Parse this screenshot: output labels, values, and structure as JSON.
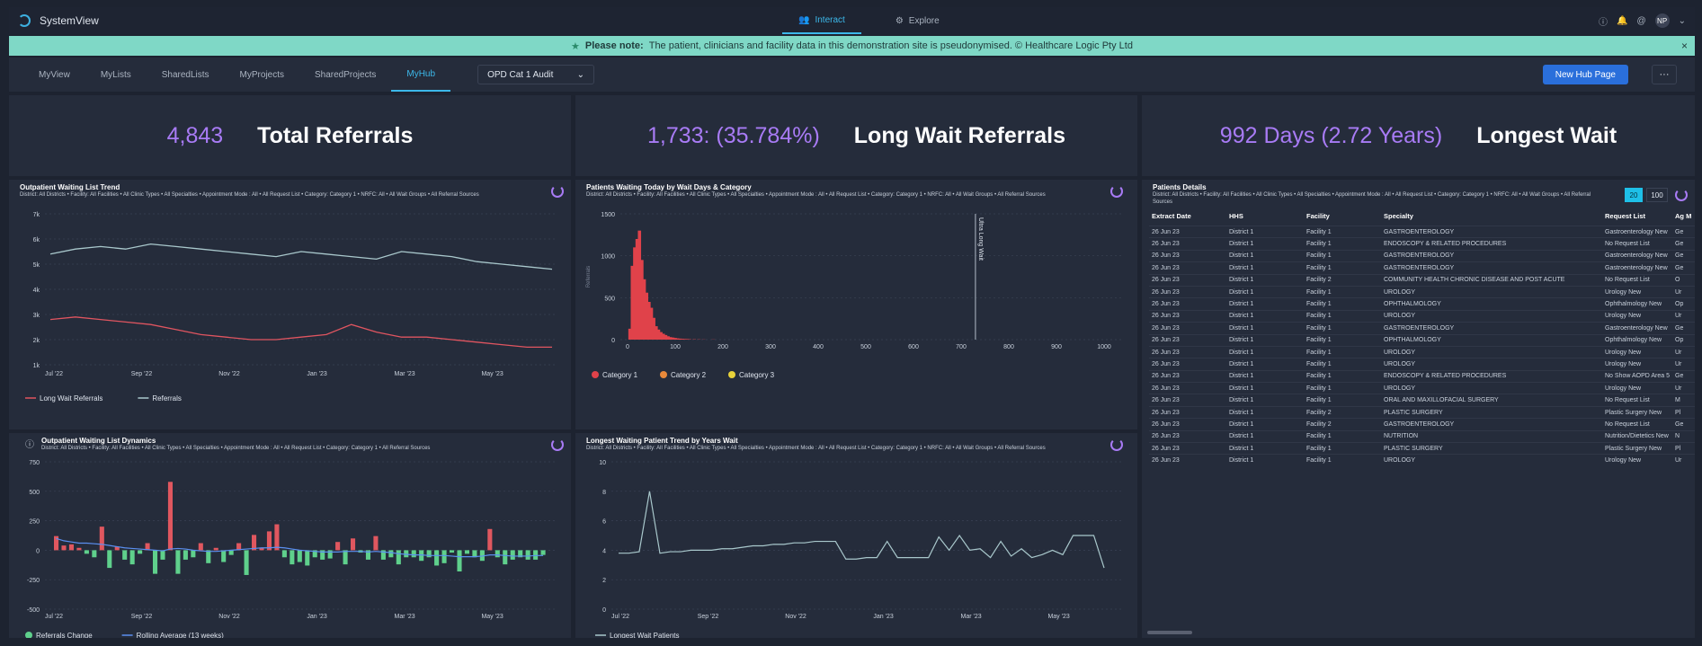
{
  "app": {
    "title": "SystemView",
    "modes": [
      {
        "label": "Interact"
      },
      {
        "label": "Explore"
      }
    ],
    "user_initials": "NP"
  },
  "notice": {
    "bold": "Please note:",
    "text": "The patient, clinicians and facility data in this demonstration site is pseudonymised. © Healthcare Logic Pty Ltd",
    "close": "×"
  },
  "tabs": [
    {
      "label": "MyView"
    },
    {
      "label": "MyLists"
    },
    {
      "label": "SharedLists"
    },
    {
      "label": "MyProjects"
    },
    {
      "label": "SharedProjects"
    },
    {
      "label": "MyHub"
    }
  ],
  "hub_select": "OPD Cat 1 Audit",
  "new_hub_button": "New Hub Page",
  "more_button": "···",
  "kpis": [
    {
      "value": "4,843",
      "label": "Total Referrals"
    },
    {
      "value": "1,733: (35.784%)",
      "label": "Long Wait Referrals"
    },
    {
      "value": "992 Days (2.72 Years)",
      "label": "Longest Wait"
    }
  ],
  "filter_text": "District: All Districts  •  Facility: All Facilities  •  All Clinic Types  •  All Specialties  •  Appointment Mode : All  •  All Request List  •  Category: Category 1  •  NRFC: All  •  All Wait Groups  •  All Referral Sources",
  "filter_text_b": "District: All Districts  •  Facility: All Facilities  •  All Clinic Types  •  All Specialties  •  Appointment Mode : All  •  All Request List  •  Category: Category 1  •  All Referral Sources",
  "chart_data": [
    {
      "title": "Outpatient Waiting List Trend",
      "type": "line",
      "x": [
        "Jul '22",
        "Sep '22",
        "Nov '22",
        "Jan '23",
        "Mar '23",
        "May '23"
      ],
      "ylim": [
        1000,
        7000
      ],
      "yticks": [
        "1k",
        "2k",
        "3k",
        "4k",
        "5k",
        "6k",
        "7k"
      ],
      "series": [
        {
          "name": "Referrals",
          "color": "#a9c8cc",
          "values": [
            5400,
            5600,
            5700,
            5600,
            5800,
            5700,
            5600,
            5500,
            5400,
            5300,
            5500,
            5400,
            5300,
            5200,
            5500,
            5400,
            5300,
            5100,
            5000,
            4900,
            4800
          ]
        },
        {
          "name": "Long Wait Referrals",
          "color": "#e05560",
          "values": [
            2800,
            2900,
            2800,
            2700,
            2600,
            2400,
            2200,
            2100,
            2000,
            2000,
            2100,
            2200,
            2600,
            2300,
            2100,
            2100,
            2000,
            1900,
            1800,
            1700,
            1700
          ]
        }
      ]
    },
    {
      "title": "Patients Waiting Today by Wait Days & Category",
      "type": "bar",
      "ylabel": "Referrals",
      "ylim": [
        0,
        1500
      ],
      "yticks": [
        "0",
        "500",
        "1000",
        "1500"
      ],
      "xticks": [
        "0",
        "100",
        "200",
        "300",
        "400",
        "500",
        "600",
        "700",
        "800",
        "900",
        "1000"
      ],
      "annotation": {
        "label": "Ultra Long Wait",
        "x": 730
      },
      "series": [
        {
          "name": "Category 1",
          "color": "#e0424a"
        },
        {
          "name": "Category 2",
          "color": "#e8893a"
        },
        {
          "name": "Category 3",
          "color": "#e8d23a"
        }
      ],
      "bars": [
        {
          "x": 5,
          "v": 130
        },
        {
          "x": 10,
          "v": 880
        },
        {
          "x": 15,
          "v": 1100
        },
        {
          "x": 20,
          "v": 1200
        },
        {
          "x": 25,
          "v": 1300
        },
        {
          "x": 30,
          "v": 950
        },
        {
          "x": 35,
          "v": 720
        },
        {
          "x": 40,
          "v": 560
        },
        {
          "x": 45,
          "v": 450
        },
        {
          "x": 50,
          "v": 380
        },
        {
          "x": 55,
          "v": 260
        },
        {
          "x": 60,
          "v": 160
        },
        {
          "x": 65,
          "v": 120
        },
        {
          "x": 70,
          "v": 90
        },
        {
          "x": 75,
          "v": 70
        },
        {
          "x": 80,
          "v": 55
        },
        {
          "x": 85,
          "v": 40
        },
        {
          "x": 90,
          "v": 30
        },
        {
          "x": 95,
          "v": 25
        },
        {
          "x": 100,
          "v": 20
        },
        {
          "x": 105,
          "v": 15
        },
        {
          "x": 110,
          "v": 12
        },
        {
          "x": 115,
          "v": 10
        },
        {
          "x": 120,
          "v": 8
        },
        {
          "x": 125,
          "v": 7
        },
        {
          "x": 130,
          "v": 5
        },
        {
          "x": 140,
          "v": 4
        },
        {
          "x": 150,
          "v": 3
        },
        {
          "x": 160,
          "v": 2
        },
        {
          "x": 180,
          "v": 2
        }
      ]
    },
    {
      "title": "Outpatient Waiting List Dynamics",
      "type": "bar",
      "x": [
        "Jul '22",
        "Sep '22",
        "Nov '22",
        "Jan '23",
        "Mar '23",
        "May '23"
      ],
      "ylim": [
        -500,
        750
      ],
      "yticks": [
        "-500",
        "-250",
        "0",
        "250",
        "500",
        "750"
      ],
      "series": [
        {
          "name": "Referrals Change",
          "color": "#5fd08c",
          "values": [
            120,
            40,
            50,
            20,
            -30,
            -60,
            200,
            -150,
            30,
            -80,
            -120,
            -30,
            60,
            -200,
            -80,
            580,
            -200,
            -80,
            -60,
            60,
            -110,
            20,
            -100,
            -40,
            60,
            -210,
            130,
            20,
            160,
            220,
            -60,
            -120,
            -100,
            -130,
            -60,
            -80,
            -70,
            70,
            -120,
            100,
            -20,
            -80,
            120,
            -80,
            -60,
            -120,
            -60,
            -60,
            -90,
            -60,
            -130,
            -110,
            -20,
            -180,
            -30,
            -60,
            -90,
            180,
            -60,
            -120,
            -80,
            -60,
            -80,
            -80,
            -40
          ]
        },
        {
          "name": "Rolling Average (13 weeks)",
          "color": "#5b8ff0",
          "values": [
            100,
            80,
            70,
            60,
            60,
            55,
            50,
            40,
            30,
            20,
            15,
            10,
            5,
            0,
            -5,
            10,
            15,
            10,
            0,
            -5,
            -10,
            -10,
            -5,
            0,
            5,
            10,
            15,
            20,
            20,
            25,
            20,
            10,
            0,
            -5,
            -10,
            -15,
            -15,
            -15,
            -10,
            -10,
            -10,
            -15,
            -10,
            -15,
            -20,
            -30,
            -35,
            -40,
            -40,
            -45,
            -45,
            -45,
            -50,
            -55,
            -55,
            -55,
            -50,
            -40,
            -40,
            -45,
            -50,
            -50,
            -50,
            -45,
            -45
          ]
        }
      ]
    },
    {
      "title": "Longest Waiting Patient Trend by Years Wait",
      "type": "line",
      "x": [
        "Jul '22",
        "Sep '22",
        "Nov '22",
        "Jan '23",
        "Mar '23",
        "May '23"
      ],
      "ylim": [
        0,
        10
      ],
      "yticks": [
        "0",
        "2",
        "4",
        "6",
        "8",
        "10"
      ],
      "series": [
        {
          "name": "Longest Wait Patients",
          "color": "#a9c8cc",
          "values": [
            3.8,
            3.8,
            3.9,
            8.0,
            3.8,
            3.9,
            3.9,
            4.0,
            4.0,
            4.0,
            4.1,
            4.1,
            4.2,
            4.3,
            4.3,
            4.4,
            4.4,
            4.5,
            4.5,
            4.6,
            4.6,
            4.6,
            3.4,
            3.4,
            3.5,
            3.5,
            4.6,
            3.5,
            3.5,
            3.5,
            3.5,
            4.9,
            4.0,
            5.0,
            4.0,
            4.1,
            3.5,
            4.6,
            3.6,
            4.1,
            3.5,
            3.7,
            4.0,
            3.7,
            5.0,
            5.0,
            5.0,
            2.8
          ]
        }
      ]
    }
  ],
  "table": {
    "title": "Patients Details",
    "page_sizes": [
      "20",
      "100"
    ],
    "columns": [
      "Extract Date",
      "HHS",
      "Facility",
      "Specialty",
      "Request List",
      "Ag M"
    ],
    "rows": [
      [
        "26 Jun 23",
        "District 1",
        "Facility 1",
        "GASTROENTEROLOGY",
        "Gastroenterology New",
        "Ge"
      ],
      [
        "26 Jun 23",
        "District 1",
        "Facility 1",
        "ENDOSCOPY & RELATED PROCEDURES",
        "No Request List",
        "Ge"
      ],
      [
        "26 Jun 23",
        "District 1",
        "Facility 1",
        "GASTROENTEROLOGY",
        "Gastroenterology New",
        "Ge"
      ],
      [
        "26 Jun 23",
        "District 1",
        "Facility 1",
        "GASTROENTEROLOGY",
        "Gastroenterology New",
        "Ge"
      ],
      [
        "26 Jun 23",
        "District 1",
        "Facility 2",
        "COMMUNITY HEALTH CHRONIC DISEASE AND POST ACUTE",
        "No Request List",
        "O"
      ],
      [
        "26 Jun 23",
        "District 1",
        "Facility 1",
        "UROLOGY",
        "Urology New",
        "Ur"
      ],
      [
        "26 Jun 23",
        "District 1",
        "Facility 1",
        "OPHTHALMOLOGY",
        "Ophthalmology New",
        "Op"
      ],
      [
        "26 Jun 23",
        "District 1",
        "Facility 1",
        "UROLOGY",
        "Urology New",
        "Ur"
      ],
      [
        "26 Jun 23",
        "District 1",
        "Facility 1",
        "GASTROENTEROLOGY",
        "Gastroenterology New",
        "Ge"
      ],
      [
        "26 Jun 23",
        "District 1",
        "Facility 1",
        "OPHTHALMOLOGY",
        "Ophthalmology New",
        "Op"
      ],
      [
        "26 Jun 23",
        "District 1",
        "Facility 1",
        "UROLOGY",
        "Urology New",
        "Ur"
      ],
      [
        "26 Jun 23",
        "District 1",
        "Facility 1",
        "UROLOGY",
        "Urology New",
        "Ur"
      ],
      [
        "26 Jun 23",
        "District 1",
        "Facility 1",
        "ENDOSCOPY & RELATED PROCEDURES",
        "No Show AOPD Area 5",
        "Ge"
      ],
      [
        "26 Jun 23",
        "District 1",
        "Facility 1",
        "UROLOGY",
        "Urology New",
        "Ur"
      ],
      [
        "26 Jun 23",
        "District 1",
        "Facility 1",
        "ORAL AND MAXILLOFACIAL SURGERY",
        "No Request List",
        "M"
      ],
      [
        "26 Jun 23",
        "District 1",
        "Facility 2",
        "PLASTIC SURGERY",
        "Plastic Surgery New",
        "Pl"
      ],
      [
        "26 Jun 23",
        "District 1",
        "Facility 2",
        "GASTROENTEROLOGY",
        "No Request List",
        "Ge"
      ],
      [
        "26 Jun 23",
        "District 1",
        "Facility 1",
        "NUTRITION",
        "Nutrition/Dietetics New",
        "N"
      ],
      [
        "26 Jun 23",
        "District 1",
        "Facility 1",
        "PLASTIC SURGERY",
        "Plastic Surgery New",
        "Pl"
      ],
      [
        "26 Jun 23",
        "District 1",
        "Facility 1",
        "UROLOGY",
        "Urology New",
        "Ur"
      ]
    ]
  }
}
